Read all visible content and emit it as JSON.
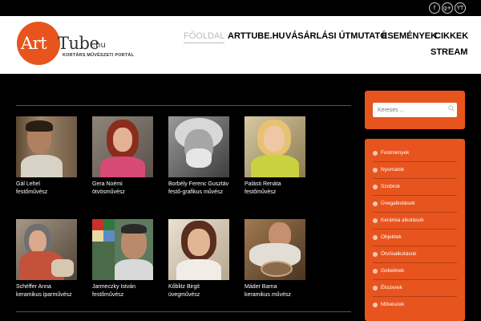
{
  "social": [
    {
      "label": "f",
      "icon": "facebook-icon"
    },
    {
      "label": "g+",
      "icon": "google-plus-icon"
    },
    {
      "label": "YT",
      "icon": "youtube-icon"
    }
  ],
  "logo": {
    "art": "Art",
    "tube": "Tube",
    "hu": ".hu",
    "tagline": "KORTÁRS MŰVÉSZETI PORTÁL"
  },
  "nav": [
    "FŐOLDAL",
    "ARTTUBE.HU",
    "VÁSÁRLÁSI ÚTMUTATÓ",
    "ESEMÉNYEK",
    "CIKKEK",
    "STREAM"
  ],
  "artists": [
    {
      "name": "Gál Lehel",
      "role": "festőművész"
    },
    {
      "name": "Gera Noémi",
      "role": "ötvösművész"
    },
    {
      "name": "Borbély Ferenc Gusztáv",
      "role": " festő-grafikus művész"
    },
    {
      "name": "Palásti Renáta",
      "role": "festőművész"
    },
    {
      "name": "Schéffer Anna",
      "role": "keramikus iparművész"
    },
    {
      "name": "Jarmeczky István",
      "role": "festőművész"
    },
    {
      "name": "Kőblitz Birgit",
      "role": "üvegművész"
    },
    {
      "name": "Máder Barna",
      "role": " keramikus művész"
    }
  ],
  "search": {
    "placeholder": "Keresés ..."
  },
  "categories": [
    "Festmények",
    "Nyomatok",
    "Szobrok",
    "Üvegalkotások",
    "Kerámia alkotások",
    "Objektek",
    "Ötvösalkotások",
    "Gobelinek",
    "Ékszerek",
    "Művészek"
  ],
  "colors": {
    "accent": "#e8541e",
    "background": "#000000"
  }
}
